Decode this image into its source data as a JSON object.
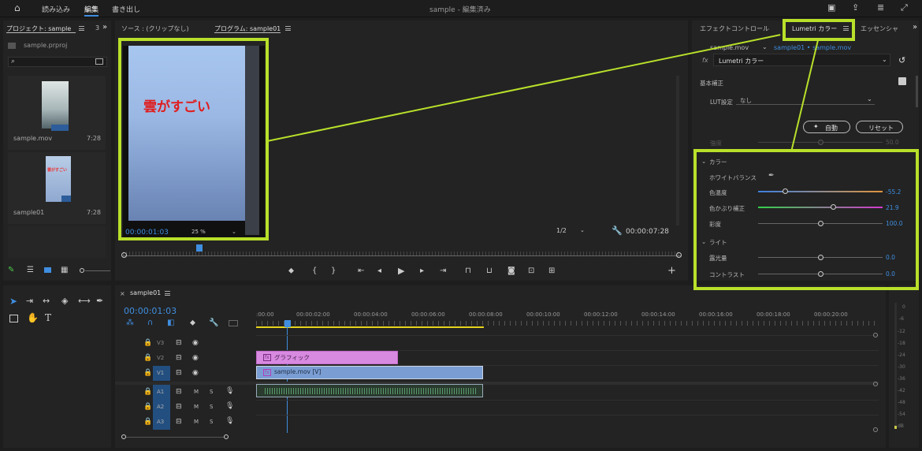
{
  "topbar": {
    "import": "読み込み",
    "edit": "編集",
    "export": "書き出し",
    "title": "sample - 編集済み"
  },
  "project": {
    "tab": "プロジェクト: sample",
    "tab_more": "3",
    "file": "sample.prproj",
    "items": [
      {
        "name": "sample.mov",
        "dur": "7:28"
      },
      {
        "name": "sample01",
        "dur": "7:28",
        "thumb_text": "雲がすごい"
      }
    ]
  },
  "source": {
    "tab": "ソース : (クリップなし)"
  },
  "program": {
    "tab": "プログラム: sample01",
    "caption": "雲がすごい",
    "timecode": "00:00:01:03",
    "zoom": "25 %",
    "fraction": "1/2",
    "duration": "00:00:07:28"
  },
  "effects": {
    "tab_effect": "エフェクトコントロール",
    "tab_lumetri": "Lumetri カラー",
    "tab_essential": "エッセンシャ",
    "clip": "sample.mov",
    "sequence": "sample01 • sample.mov",
    "fx_label": "Lumetri カラー",
    "basic": "基本補正",
    "lut_label": "LUT設定",
    "lut_value": "なし",
    "auto_btn": "自動",
    "reset_btn": "リセット",
    "intensity_label": "強度",
    "intensity_value": "50.0",
    "color_section": "カラー",
    "wb": "ホワイトバランス",
    "temp_label": "色温度",
    "temp_value": "-55.2",
    "tint_label": "色かぶり補正",
    "tint_value": "21.9",
    "sat_label": "彩度",
    "sat_value": "100.0",
    "light_section": "ライト",
    "exposure_label": "露光量",
    "exposure_value": "0.0",
    "contrast_label": "コントラスト",
    "contrast_value": "0.0"
  },
  "timeline": {
    "tab": "sample01",
    "timecode": "00:00:01:03",
    "ruler": [
      ":00:00",
      "00:00:02:00",
      "00:00:04:00",
      "00:00:06:00",
      "00:00:08:00",
      "00:00:10:00",
      "00:00:12:00",
      "00:00:14:00",
      "00:00:16:00",
      "00:00:18:00",
      "00:00:20:00"
    ],
    "tracks": [
      "V3",
      "V2",
      "V1",
      "A1",
      "A2",
      "A3"
    ],
    "graphic_clip": "グラフィック",
    "video_clip": "sample.mov [V]",
    "audio_meter": [
      "0",
      "-6",
      "-12",
      "-18",
      "-24",
      "-30",
      "-36",
      "-42",
      "-48",
      "-54",
      "dB"
    ],
    "m_label": "M",
    "s_label": "S"
  },
  "colors": {
    "accent": "#b8e02a",
    "clip_pink": "#d889e0",
    "clip_blue": "#7a9ed4",
    "timecode_blue": "#3f8ee0"
  }
}
